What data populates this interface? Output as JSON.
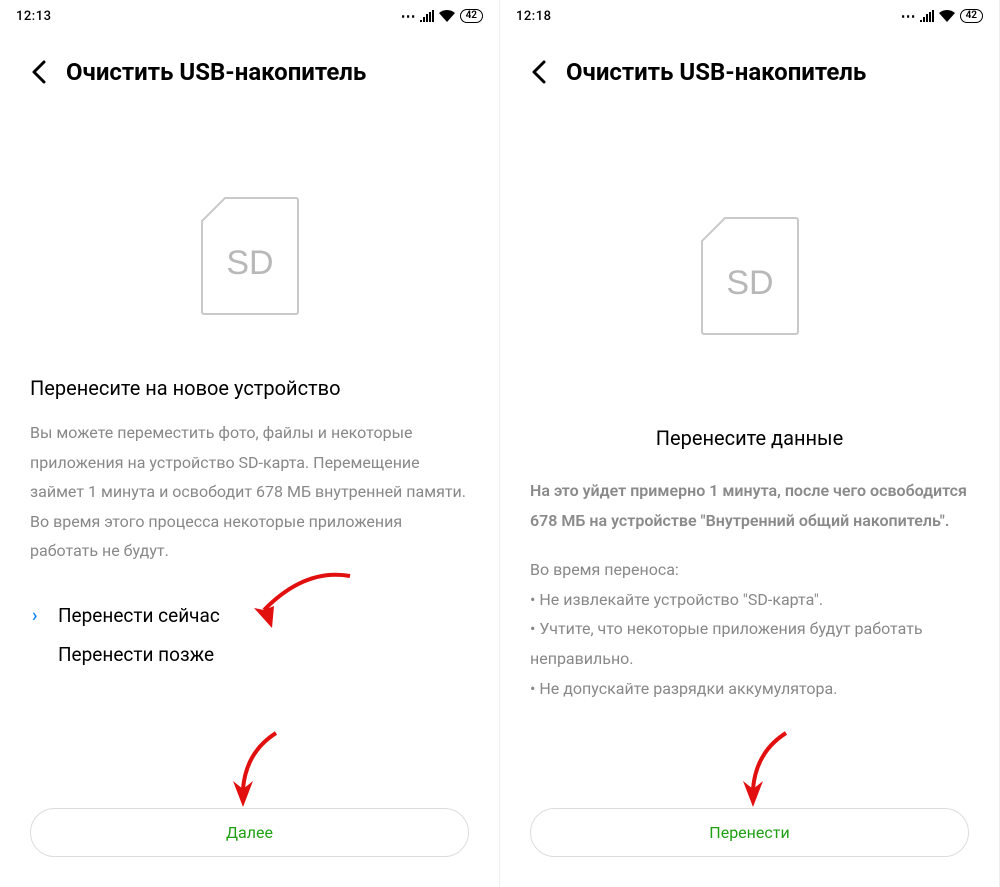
{
  "left": {
    "status": {
      "time": "12:13",
      "battery": "42"
    },
    "title": "Очистить USB-накопитель",
    "sd_label": "SD",
    "heading": "Перенесите на новое устройство",
    "body": "Вы можете переместить фото, файлы и некоторые приложения на устройство SD-карта. Перемещение займет 1 минута и освободит 678 МБ внутренней памяти. Во время этого процесса некоторые приложения работать не будут.",
    "option_now": "Перенести сейчас",
    "option_later": "Перенести позже",
    "button": "Далее"
  },
  "right": {
    "status": {
      "time": "12:18",
      "battery": "42"
    },
    "title": "Очистить USB-накопитель",
    "sd_label": "SD",
    "heading": "Перенесите данные",
    "body_bold": "На это уйдет примерно 1 минута, после чего освободится 678 МБ на устройстве \"Внутренний общий накопитель\".",
    "notes_intro": "Во время переноса:",
    "notes": [
      "• Не извлекайте устройство \"SD-карта\".",
      "• Учтите, что некоторые приложения будут работать неправильно.",
      "• Не допускайте разрядки аккумулятора."
    ],
    "button": "Перенести"
  }
}
